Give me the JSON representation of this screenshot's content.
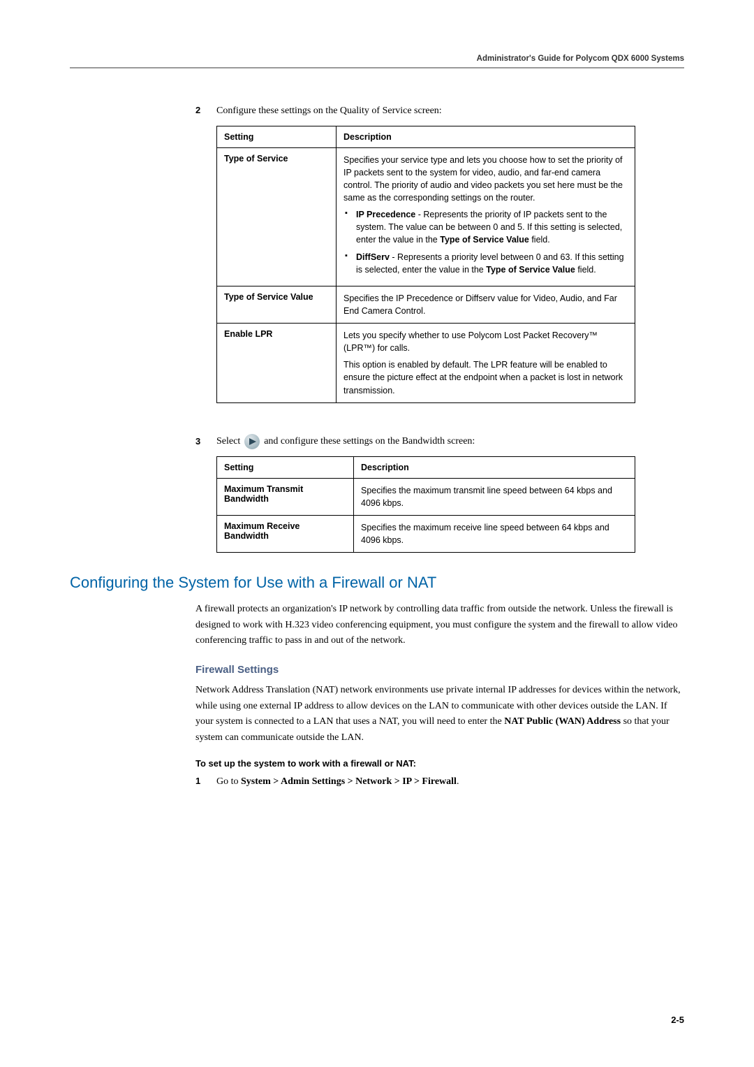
{
  "header": {
    "title": "Administrator's Guide for Polycom QDX 6000 Systems"
  },
  "step2": {
    "num": "2",
    "text": "Configure these settings on the Quality of Service screen:"
  },
  "table1": {
    "h_setting": "Setting",
    "h_desc": "Description",
    "r1_label": "Type of Service",
    "r1_p1": "Specifies your service type and lets you choose how to set the priority of IP packets sent to the system for video, audio, and far-end camera control. The priority of audio and video packets you set here must be the same as the corresponding settings on the router.",
    "r1_b1a": "IP Precedence",
    "r1_b1b": " - Represents the priority of IP packets sent to the system. The value can be between 0 and 5. If this setting is selected, enter the value in the ",
    "r1_b1c": "Type of Service Value",
    "r1_b1d": " field.",
    "r1_b2a": "DiffServ",
    "r1_b2b": " - Represents a priority level between 0 and 63. If this setting is selected, enter the value in the ",
    "r1_b2c": "Type of Service Value",
    "r1_b2d": " field.",
    "r2_label": "Type of Service Value",
    "r2_p1": "Specifies the IP Precedence or Diffserv value for Video, Audio, and Far End Camera Control.",
    "r3_label": "Enable LPR",
    "r3_p1": "Lets you specify whether to use Polycom Lost Packet Recovery™ (LPR™) for calls.",
    "r3_p2": "This option is enabled by default. The LPR feature will be enabled to ensure the picture effect at the endpoint when a packet is lost in network transmission."
  },
  "step3": {
    "num": "3",
    "text_a": "Select ",
    "text_b": " and configure these settings on the Bandwidth screen:"
  },
  "table2": {
    "h_setting": "Setting",
    "h_desc": "Description",
    "r1_label": "Maximum Transmit Bandwidth",
    "r1_p1": "Specifies the maximum transmit line speed between 64 kbps and 4096 kbps.",
    "r2_label": "Maximum Receive Bandwidth",
    "r2_p1": "Specifies the maximum receive line speed between 64 kbps and 4096 kbps."
  },
  "section": {
    "title": "Configuring the System for Use with a Firewall or NAT",
    "para": "A firewall protects an organization's IP network by controlling data traffic from outside the network. Unless the firewall is designed to work with H.323 video conferencing equipment, you must configure the system and the firewall to allow video conferencing traffic to pass in and out of the network."
  },
  "firewall": {
    "title": "Firewall Settings",
    "para_a": "Network Address Translation (NAT) network environments use private internal IP addresses for devices within the network, while using one external IP address to allow devices on the LAN to communicate with other devices outside the LAN. If your system is connected to a LAN that uses a NAT, you will need to enter the ",
    "para_b": "NAT Public (WAN) Address",
    "para_c": " so that your system can communicate outside the LAN.",
    "howto": "To set up the system to work with a firewall or NAT:",
    "step1_num": "1",
    "step1_a": "Go to ",
    "step1_b": "System > Admin Settings > Network > IP > Firewall",
    "step1_c": "."
  },
  "footer": {
    "pagenum": "2-5"
  }
}
